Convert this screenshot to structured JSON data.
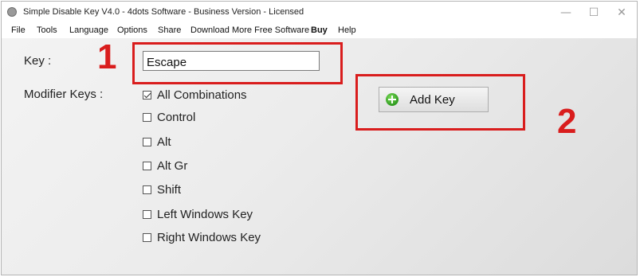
{
  "window": {
    "title": "Simple Disable Key V4.0 - 4dots Software - Business Version - Licensed",
    "controls": {
      "minimize": "—",
      "maximize": "☐",
      "close": "✕"
    }
  },
  "menu": [
    {
      "label": "File"
    },
    {
      "label": "Tools"
    },
    {
      "label": "Language"
    },
    {
      "label": "Options"
    },
    {
      "label": "Share"
    },
    {
      "label": "Download More Free Software"
    },
    {
      "label": "Buy"
    },
    {
      "label": "Help"
    }
  ],
  "form": {
    "key_label": "Key :",
    "key_value": "Escape",
    "modifier_label": "Modifier Keys :",
    "modifiers": [
      {
        "label": "All Combinations",
        "checked": true
      },
      {
        "label": "Control",
        "checked": false
      },
      {
        "label": "Alt",
        "checked": false
      },
      {
        "label": "Alt Gr",
        "checked": false
      },
      {
        "label": "Shift",
        "checked": false
      },
      {
        "label": "Left Windows Key",
        "checked": false
      },
      {
        "label": "Right Windows Key",
        "checked": false
      }
    ],
    "add_button": "Add Key"
  },
  "annotations": {
    "callout_1": "1",
    "callout_2": "2",
    "color": "#d91d1d"
  }
}
